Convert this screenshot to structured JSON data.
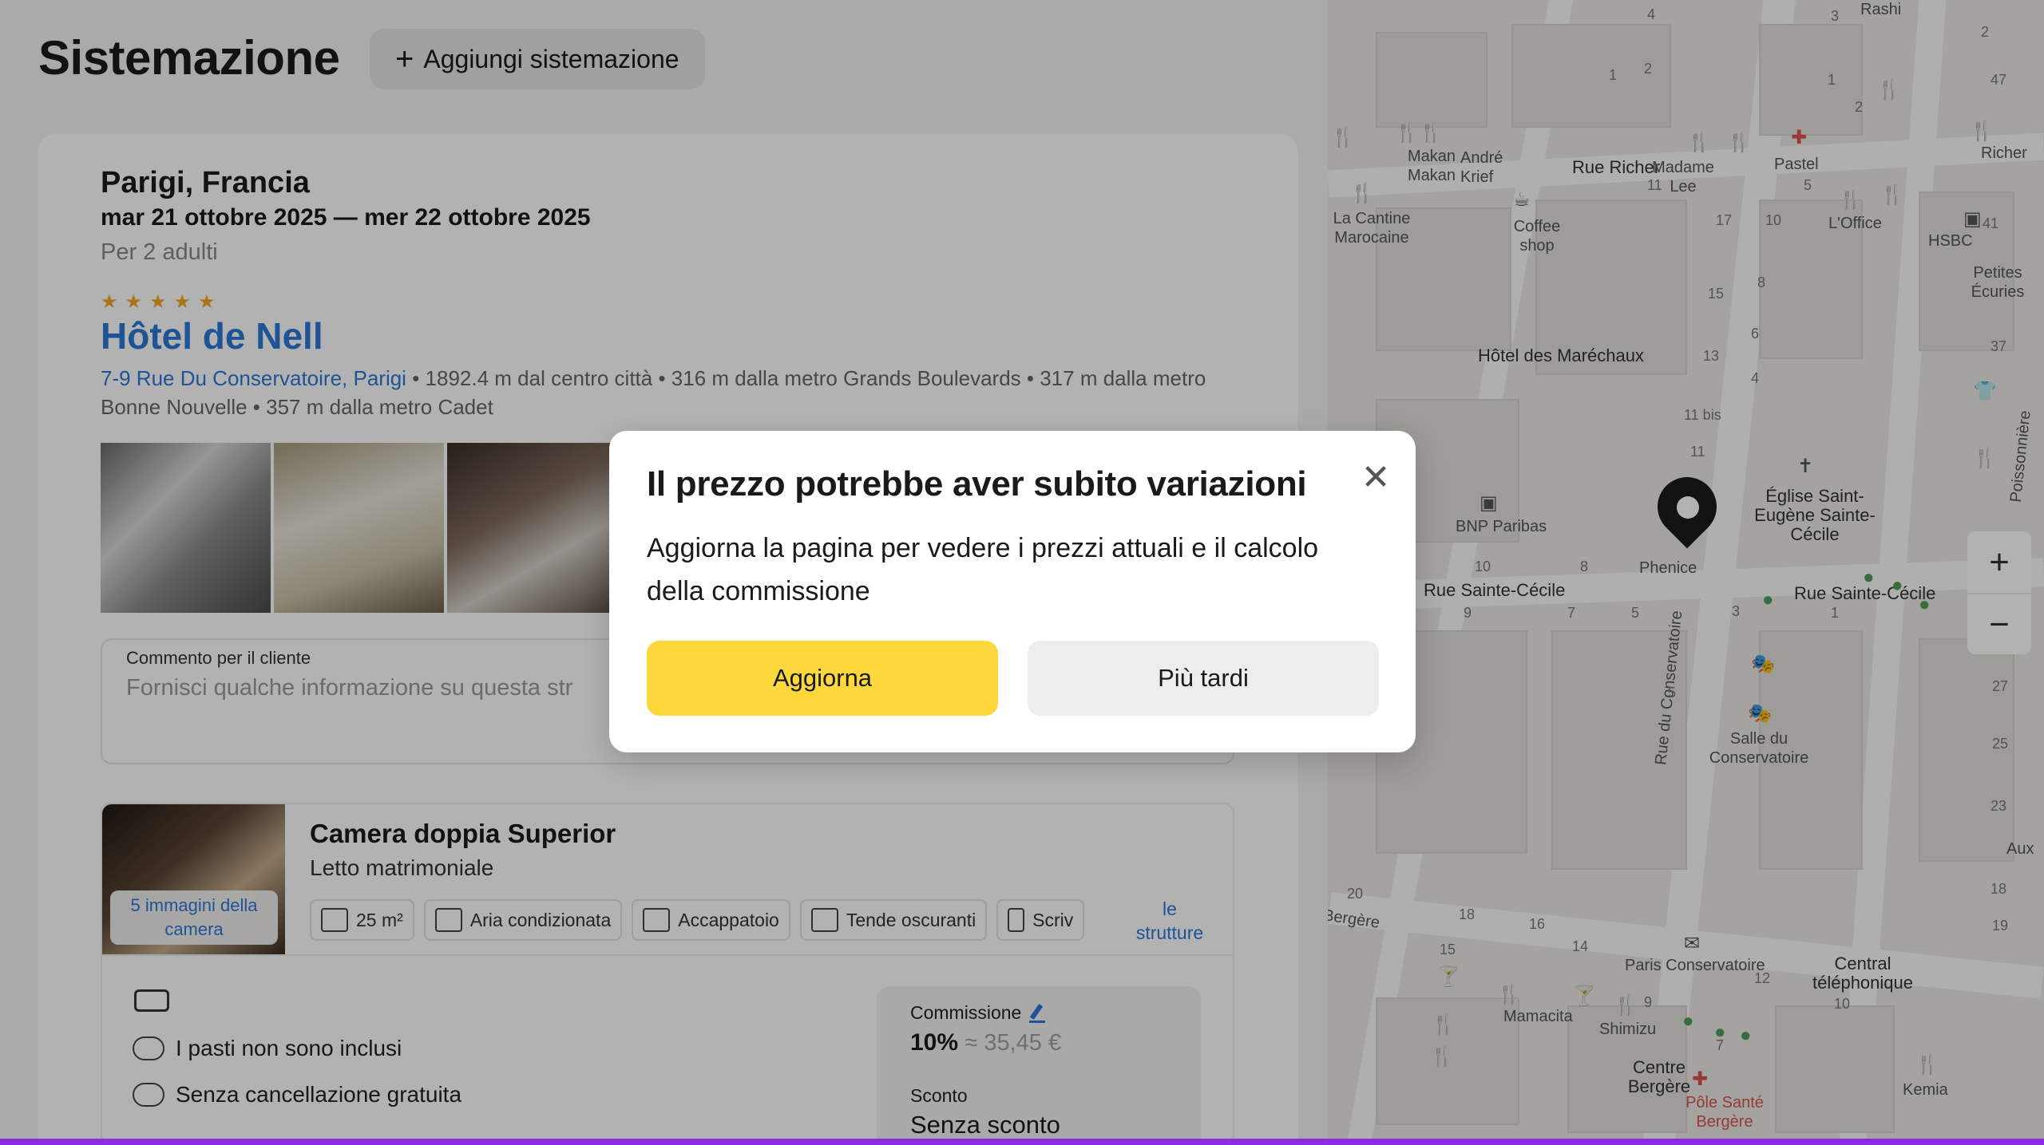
{
  "page": {
    "title": "Sistemazione",
    "add_button": "Aggiungi sistemazione"
  },
  "booking": {
    "city": "Parigi, Francia",
    "dates": "mar 21 ottobre 2025 — mer 22 ottobre 2025",
    "guests": "Per 2 adulti",
    "stars": 5,
    "hotel_name": "Hôtel de Nell",
    "address_link": "7-9 Rue Du Conservatoire, Parigi",
    "address_details": " • 1892.4 m dal centro città • 316 m dalla metro Grands Boulevards • 317 m dalla metro Bonne Nouvelle • 357 m dalla metro Cadet"
  },
  "comment": {
    "label": "Commento per il cliente",
    "placeholder": "Fornisci qualche informazione su questa str"
  },
  "room": {
    "photo_badge": "5 immagini della camera",
    "title": "Camera doppia Superior",
    "subtitle": "Letto matrimoniale",
    "amenities": [
      "25 m²",
      "Aria condizionata",
      "Accappatoio",
      "Tende oscuranti",
      "Scriv"
    ],
    "more_link": "le strutture",
    "meals": "I pasti non sono inclusi",
    "cancellation": "Senza cancellazione gratuita",
    "commission_label": "Commissione",
    "commission_value": "10%",
    "commission_approx": "≈ 35,45 €",
    "discount_label": "Sconto",
    "discount_value": "Senza sconto"
  },
  "map": {
    "labels": {
      "rashi": "Rashi",
      "makan": "Makan Makan",
      "andre": "André Krief",
      "rue_richer": "Rue Richer",
      "madame": "Madame Lee",
      "pastel": "Pastel",
      "richer": "Richer",
      "cantine": "La Cantine Marocaine",
      "coffee": "Coffee shop",
      "loffice": "L'Office",
      "hsbc": "HSBC",
      "petites": "Petites Écuries",
      "hotel_mar": "Hôtel des Maréchaux",
      "bnp": "BNP Paribas",
      "phenice": "Phenice",
      "eglise": "Église Saint-Eugène Sainte-Cécile",
      "rue_cecile_l": "Rue Sainte-Cécile",
      "rue_cecile_r": "Rue Sainte-Cécile",
      "rue_conserv": "Rue du Conservatoire",
      "salle": "Salle du Conservatoire",
      "paris_cons": "Paris Conservatoire",
      "central": "Central téléphonique",
      "mamacita": "Mamacita",
      "shimizu": "Shimizu",
      "centre": "Centre Bergère",
      "pole": "Pôle Santé Bergère",
      "kemia": "Kemia",
      "bergere": "Bergère",
      "poissonniere": "Poissonnière",
      "aux": "Aux"
    }
  },
  "modal": {
    "title": "Il prezzo potrebbe aver subito variazioni",
    "body": "Aggiorna la pagina per vedere i prezzi attuali e il calcolo della commissione",
    "primary": "Aggiorna",
    "secondary": "Più tardi"
  },
  "colors": {
    "accent_link": "#2b78d6",
    "primary_button": "#fcd83d",
    "star": "#f5a623",
    "bottom_bar": "#8b2be2"
  }
}
